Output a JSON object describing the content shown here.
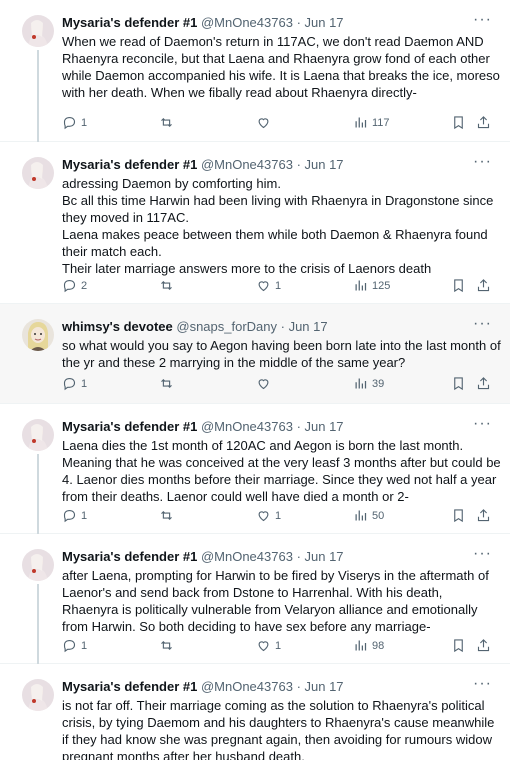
{
  "tweets": [
    {
      "name": "Mysaria's defender #1",
      "handle": "@MnOne43763",
      "date": "· Jun 17",
      "text": "When we read of Daemon's return in 117AC, we don't read Daemon AND Rhaenyra reconcile, but that Laena and Rhaenyra grow fond of each other while Daemon accompanied his wife. It is Laena that breaks the ice, moreso with her death. When we fibally read about Rhaenyra directly-",
      "replies": "1",
      "reposts": "",
      "likes": "",
      "views": "117"
    },
    {
      "name": "Mysaria's defender #1",
      "handle": "@MnOne43763",
      "date": "· Jun 17",
      "text": "adressing Daemon by comforting him.\nBc all this time Harwin had been living with Rhaenyra in Dragonstone since they moved in 117AC.\nLaena makes peace between them while both Daemon & Rhaenyra found their match each.\nTheir later marriage answers more to the crisis of Laenors death",
      "replies": "2",
      "reposts": "",
      "likes": "1",
      "views": "125"
    },
    {
      "name": "whimsy's devotee",
      "handle": "@snaps_forDany",
      "date": "· Jun 17",
      "text": "so what would you say to Aegon having been born late into the last month of the yr and these 2 marrying in the middle of the same year?",
      "replies": "1",
      "reposts": "",
      "likes": "",
      "views": "39"
    },
    {
      "name": "Mysaria's defender #1",
      "handle": "@MnOne43763",
      "date": "· Jun 17",
      "text": "Laena dies the 1st month of 120AC and Aegon is born the last month. Meaning that he was conceived at the very leasf 3 months after but could be 4. Laenor dies months before their marriage. Since they wed not half a year from their deaths. Laenor could well have died a month or 2-",
      "replies": "1",
      "reposts": "",
      "likes": "1",
      "views": "50"
    },
    {
      "name": "Mysaria's defender #1",
      "handle": "@MnOne43763",
      "date": "· Jun 17",
      "text": "after Laena, prompting for Harwin to be fired by Viserys in the aftermath of Laenor's and send back from Dstone to Harrenhal. With his death, Rhaenyra is politically vulnerable from Velaryon alliance and emotionally from Harwin. So both deciding to have sex before any marriage-",
      "replies": "1",
      "reposts": "",
      "likes": "1",
      "views": "98"
    },
    {
      "name": "Mysaria's defender #1",
      "handle": "@MnOne43763",
      "date": "· Jun 17",
      "text": "is not far off. Their marriage coming as the solution to Rhaenyra's political crisis, by tying Daemom and his daughters to Rhaenyra's cause meanwhile if they had know she was pregnant again, then avoiding for rumours widow pregnant months after her husband death.",
      "replies": "",
      "reposts": "",
      "likes": "",
      "views": ""
    }
  ],
  "icons": {
    "reply": "reply-icon",
    "repost": "repost-icon",
    "like": "heart-icon",
    "views": "views-icon",
    "bookmark": "bookmark-icon",
    "share": "share-icon",
    "more": "more-icon"
  },
  "colors": {
    "text": "#0f1419",
    "secondary": "#536471",
    "highlight_bg": "#f7f7f7",
    "accent_red": "#c0392b"
  }
}
